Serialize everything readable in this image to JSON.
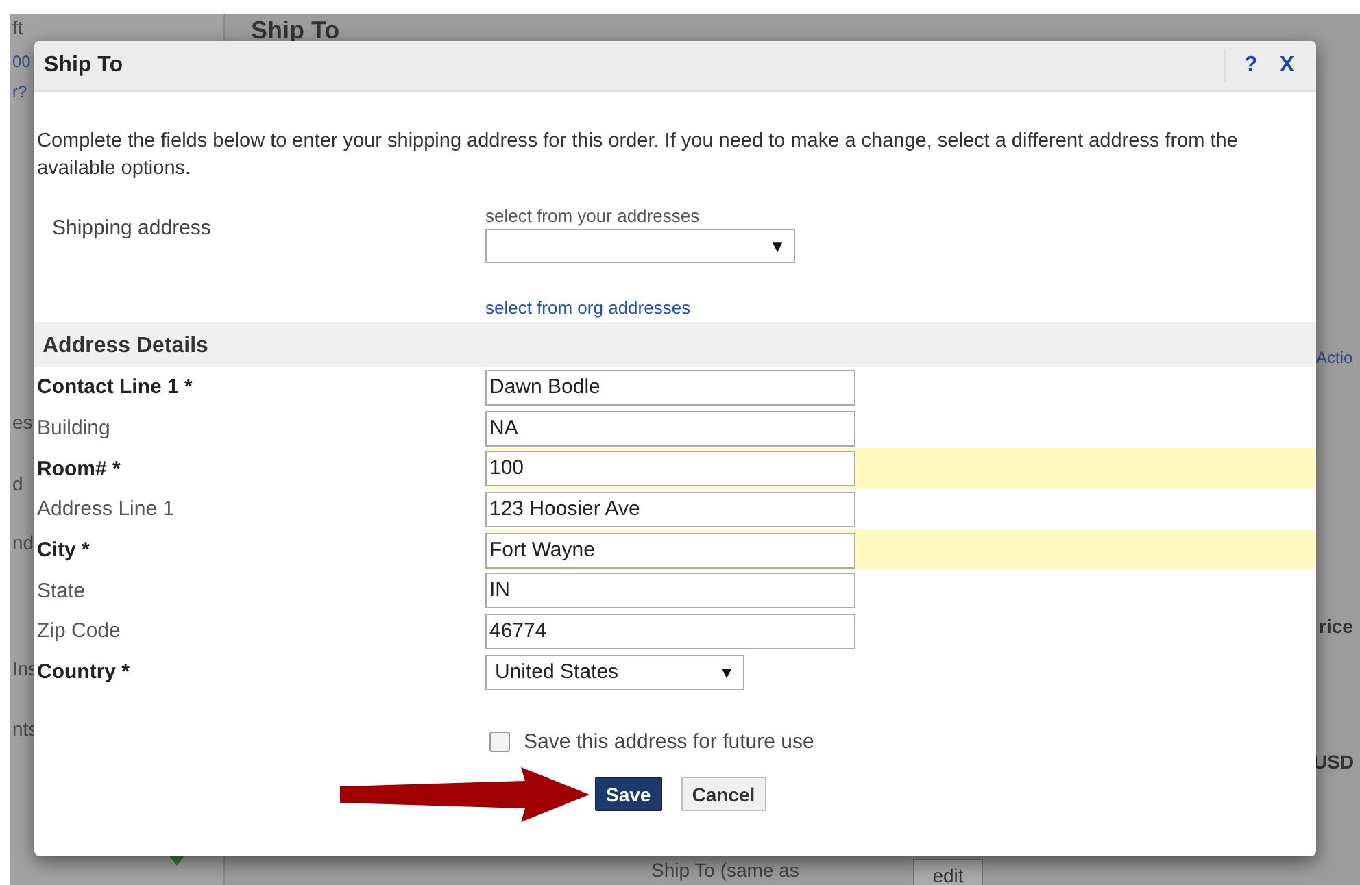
{
  "background": {
    "left_texts": [
      {
        "text": "ft",
        "kind": "plain"
      },
      {
        "text": "00",
        "kind": "link"
      },
      {
        "text": "r?",
        "kind": "link"
      },
      {
        "text": "es",
        "kind": "plain"
      },
      {
        "text": "d",
        "kind": "plain"
      },
      {
        "text": "nd",
        "kind": "plain"
      },
      {
        "text": "Ins",
        "kind": "plain"
      },
      {
        "text": "nts",
        "kind": "plain"
      }
    ],
    "heading": "Ship To",
    "right_texts": [
      {
        "text": "Actio",
        "kind": "link"
      },
      {
        "text": "rice",
        "kind": "bold"
      },
      {
        "text": "USD",
        "kind": "bold"
      }
    ],
    "footer_label": "Ship To (same as",
    "footer_button": "edit"
  },
  "dialog": {
    "title": "Ship To",
    "help": "?",
    "close": "X",
    "intro": "Complete the fields below to enter your shipping address for this order. If you need to make a change, select a different address from the available options.",
    "shipping_label": "Shipping address",
    "select_caption": "select from your addresses",
    "select_value_caret": "▼",
    "org_link": "select from org addresses",
    "section": "Address Details",
    "fields": [
      {
        "label": "Contact Line 1 *",
        "value": "Dawn Bodle",
        "kind": "text",
        "required": true,
        "highlighted": false
      },
      {
        "label": "Building",
        "value": "NA",
        "kind": "text",
        "required": false,
        "highlighted": false
      },
      {
        "label": "Room# *",
        "value": "100",
        "kind": "text",
        "required": true,
        "highlighted": true
      },
      {
        "label": "Address Line 1",
        "value": "123 Hoosier Ave",
        "kind": "text",
        "required": false,
        "highlighted": false
      },
      {
        "label": "City *",
        "value": "Fort Wayne",
        "kind": "text",
        "required": true,
        "highlighted": true
      },
      {
        "label": "State",
        "value": "IN",
        "kind": "text",
        "required": false,
        "highlighted": false
      },
      {
        "label": "Zip Code",
        "value": "46774",
        "kind": "text",
        "required": false,
        "highlighted": false
      },
      {
        "label": "Country *",
        "value": "United States",
        "kind": "select",
        "required": true,
        "highlighted": false
      }
    ],
    "save_option": {
      "label": "Save this address for future use",
      "checked": false
    },
    "buttons": [
      {
        "label": "Save",
        "kind": "primary"
      },
      {
        "label": "Cancel",
        "kind": "secondary"
      }
    ]
  }
}
